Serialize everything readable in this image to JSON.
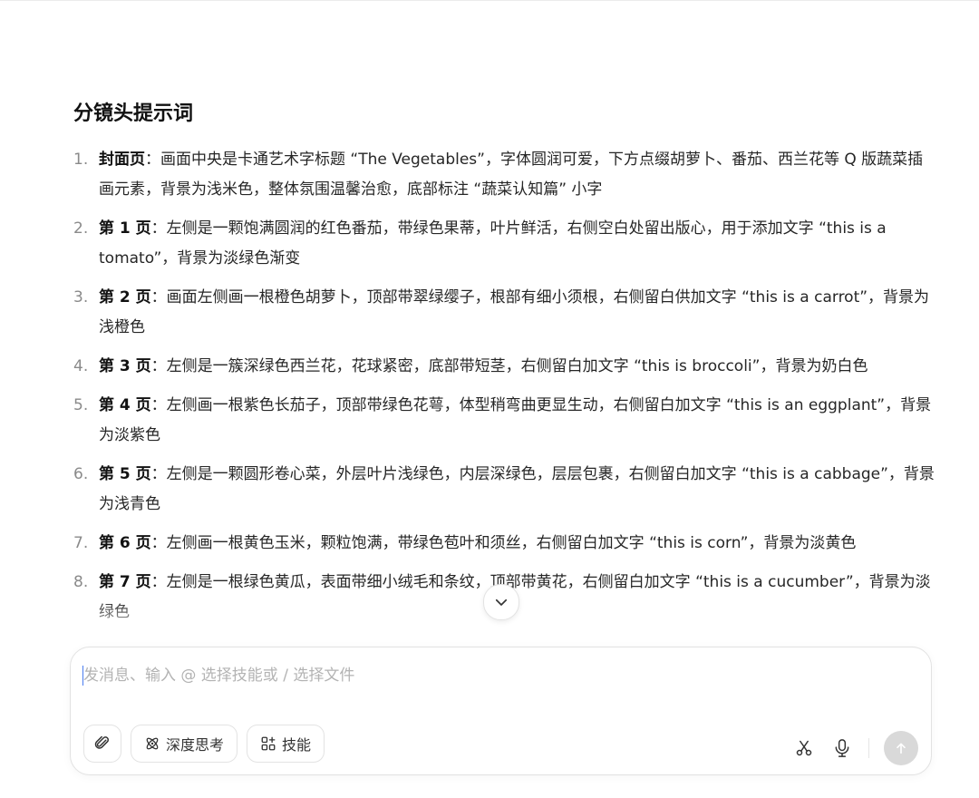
{
  "section": {
    "title": "分镜头提示词"
  },
  "items": [
    {
      "num": "1.",
      "head": "封面页",
      "sep": "：",
      "body": "画面中央是卡通艺术字标题 “The Vegetables”，字体圆润可爱，下方点缀胡萝卜、番茄、西兰花等 Q 版蔬菜插画元素，背景为浅米色，整体氛围温馨治愈，底部标注 “蔬菜认知篇” 小字"
    },
    {
      "num": "2.",
      "head": "第 1 页",
      "sep": "：",
      "body": "左侧是一颗饱满圆润的红色番茄，带绿色果蒂，叶片鲜活，右侧空白处留出版心，用于添加文字 “this is a tomato”，背景为淡绿色渐变"
    },
    {
      "num": "3.",
      "head": "第 2 页",
      "sep": "：",
      "body": "画面左侧画一根橙色胡萝卜，顶部带翠绿缨子，根部有细小须根，右侧留白供加文字 “this is a carrot”，背景为浅橙色"
    },
    {
      "num": "4.",
      "head": "第 3 页",
      "sep": "：",
      "body": "左侧是一簇深绿色西兰花，花球紧密，底部带短茎，右侧留白加文字 “this is broccoli”，背景为奶白色"
    },
    {
      "num": "5.",
      "head": "第 4 页",
      "sep": "：",
      "body": "左侧画一根紫色长茄子，顶部带绿色花萼，体型稍弯曲更显生动，右侧留白加文字 “this is an eggplant”，背景为淡紫色"
    },
    {
      "num": "6.",
      "head": "第 5 页",
      "sep": "：",
      "body": "左侧是一颗圆形卷心菜，外层叶片浅绿色，内层深绿色，层层包裹，右侧留白加文字 “this is a cabbage”，背景为浅青色"
    },
    {
      "num": "7.",
      "head": "第 6 页",
      "sep": "：",
      "body": "左侧画一根黄色玉米，颗粒饱满，带绿色苞叶和须丝，右侧留白加文字 “this is corn”，背景为淡黄色"
    },
    {
      "num": "8.",
      "head": "第 7 页",
      "sep": "：",
      "body": "左侧是一根绿色黄瓜，表面带细小绒毛和条纹，顶部带黄花，右侧留白加文字 “this is a cucumber”，背景为淡绿色"
    }
  ],
  "composer": {
    "placeholder": "发消息、输入 @ 选择技能或 / 选择文件",
    "deep_think_label": "深度思考",
    "skills_label": "技能"
  },
  "icons": {
    "attach": "paperclip-icon",
    "deep_think": "atom-icon",
    "skills": "grid-plus-icon",
    "scissors": "scissors-icon",
    "mic": "microphone-icon",
    "send": "arrow-up-icon",
    "scroll": "chevron-down-icon"
  },
  "colors": {
    "accent": "#4a7cf0",
    "send_disabled": "#d9d9d9"
  }
}
